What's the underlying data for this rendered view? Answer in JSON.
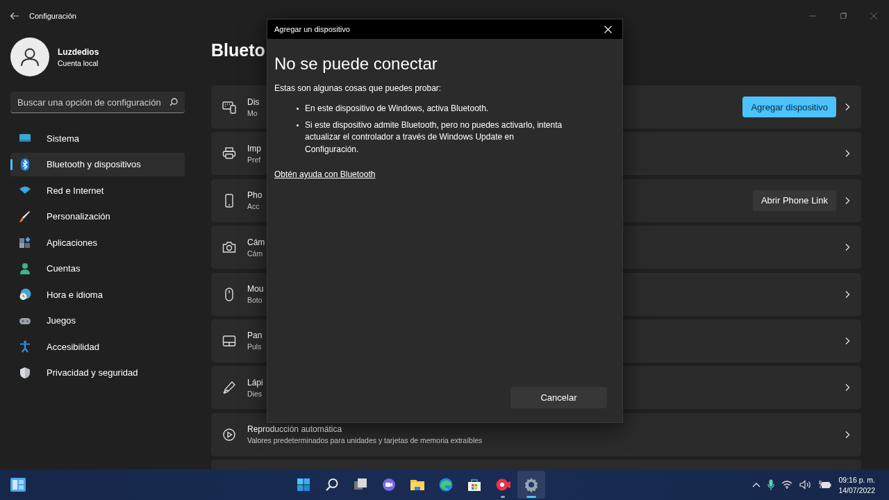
{
  "window": {
    "title": "Configuración"
  },
  "user": {
    "name": "Luzdedios",
    "account": "Cuenta local"
  },
  "search": {
    "placeholder": "Buscar una opción de configuración"
  },
  "sidebar": {
    "items": [
      {
        "label": "Sistema",
        "selected": false
      },
      {
        "label": "Bluetooth y dispositivos",
        "selected": true
      },
      {
        "label": "Red e Internet",
        "selected": false
      },
      {
        "label": "Personalización",
        "selected": false
      },
      {
        "label": "Aplicaciones",
        "selected": false
      },
      {
        "label": "Cuentas",
        "selected": false
      },
      {
        "label": "Hora e idioma",
        "selected": false
      },
      {
        "label": "Juegos",
        "selected": false
      },
      {
        "label": "Accesibilidad",
        "selected": false
      },
      {
        "label": "Privacidad y seguridad",
        "selected": false
      }
    ]
  },
  "page": {
    "title": "Blueto"
  },
  "cards": [
    {
      "title": "Dis",
      "subtitle": "Mo",
      "button": {
        "label": "Agregar dispositivo",
        "kind": "accent"
      }
    },
    {
      "title": "Imp",
      "subtitle": "Pref"
    },
    {
      "title": "Pho",
      "subtitle": "Acc",
      "button": {
        "label": "Abrir Phone Link",
        "kind": "default"
      }
    },
    {
      "title": "Cám",
      "subtitle": "Cám"
    },
    {
      "title": "Mou",
      "subtitle": "Boto"
    },
    {
      "title": "Pan",
      "subtitle": "Puls"
    },
    {
      "title": "Lápi",
      "subtitle": "Dies"
    },
    {
      "title": "Reproducción automática",
      "subtitle": "Valores predeterminados para unidades y tarjetas de memoria extraíbles"
    }
  ],
  "dialog": {
    "title": "Agregar un dispositivo",
    "heading": "No se puede conectar",
    "intro": "Estas son algunas cosas que puedes probar:",
    "bullets": [
      "En este dispositivo de Windows, activa Bluetooth.",
      "Si este dispositivo admite Bluetooth, pero no puedes activarlo, intenta actualizar el controlador a través de Windows Update en Configuración."
    ],
    "link": "Obtén ayuda con Bluetooth",
    "button": "Cancelar"
  },
  "taskbar": {
    "apps": [
      {
        "running": false,
        "selected": false
      },
      {
        "running": false,
        "selected": false
      },
      {
        "running": false,
        "selected": false
      },
      {
        "running": false,
        "selected": false
      },
      {
        "running": false,
        "selected": false
      },
      {
        "running": false,
        "selected": false
      },
      {
        "running": false,
        "selected": false
      },
      {
        "running": true,
        "selected": false
      },
      {
        "running": true,
        "selected": true
      }
    ],
    "time": "09:16 p. m.",
    "date": "14/07/2022"
  }
}
